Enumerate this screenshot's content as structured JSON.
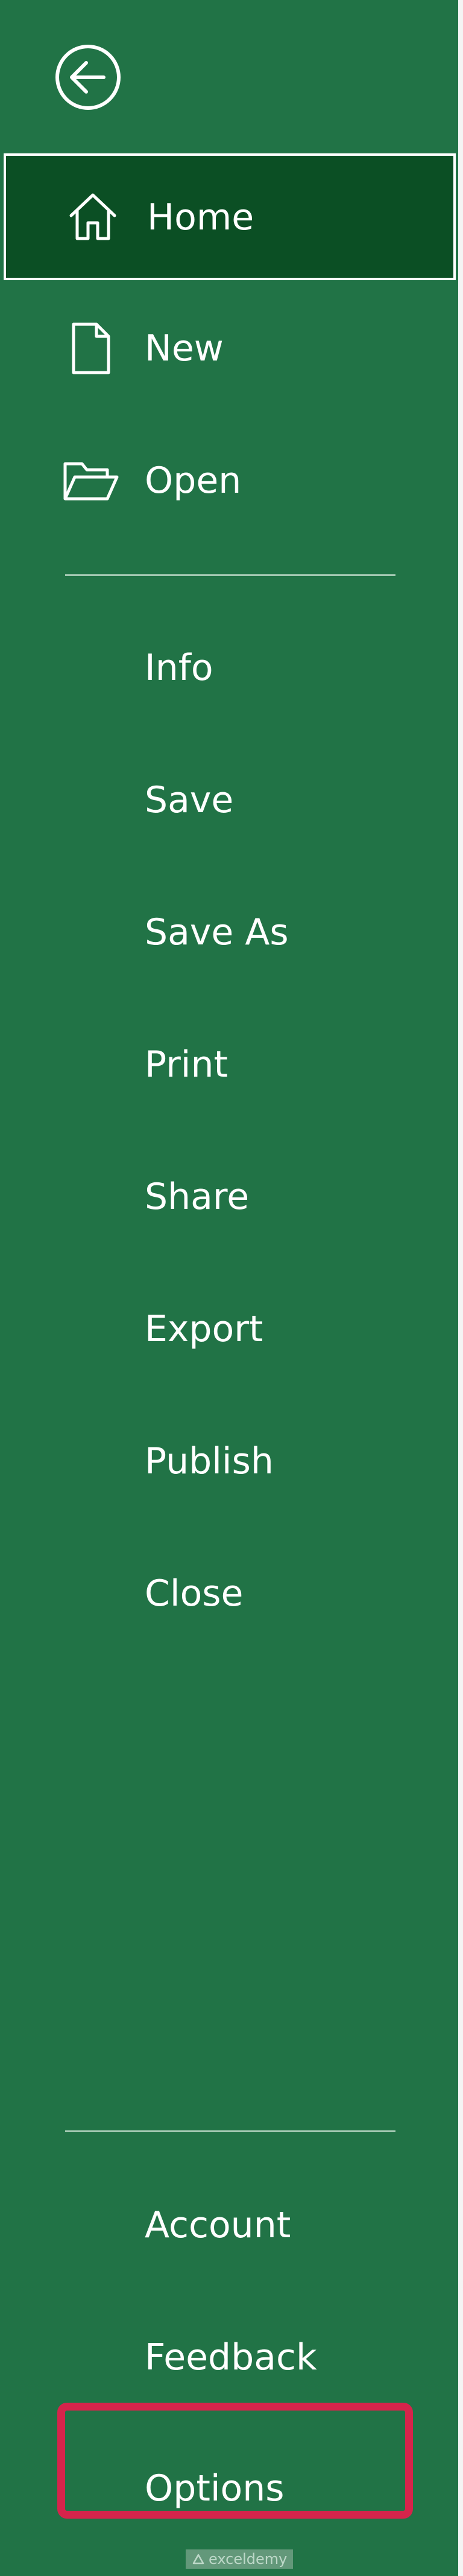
{
  "backstage": {
    "back_button_icon": "back-arrow-circle-icon",
    "items": [
      {
        "id": "home",
        "label": "Home",
        "icon": "home-icon"
      },
      {
        "id": "new",
        "label": "New",
        "icon": "new-document-icon"
      },
      {
        "id": "open",
        "label": "Open",
        "icon": "open-folder-icon"
      },
      {
        "id": "info",
        "label": "Info"
      },
      {
        "id": "save",
        "label": "Save"
      },
      {
        "id": "save-as",
        "label": "Save As"
      },
      {
        "id": "print",
        "label": "Print"
      },
      {
        "id": "share",
        "label": "Share"
      },
      {
        "id": "export",
        "label": "Export"
      },
      {
        "id": "publish",
        "label": "Publish"
      },
      {
        "id": "close",
        "label": "Close"
      },
      {
        "id": "account",
        "label": "Account"
      },
      {
        "id": "feedback",
        "label": "Feedback"
      },
      {
        "id": "options",
        "label": "Options"
      }
    ],
    "selected": "home",
    "highlighted": "options"
  },
  "watermark": {
    "text": "exceldemy",
    "icon": "exceldemy-logo-icon"
  },
  "colors": {
    "backstage_green": "#217346",
    "selected_bg": "#0b4f24",
    "highlight_red": "#d6244b",
    "text": "#ffffff"
  }
}
